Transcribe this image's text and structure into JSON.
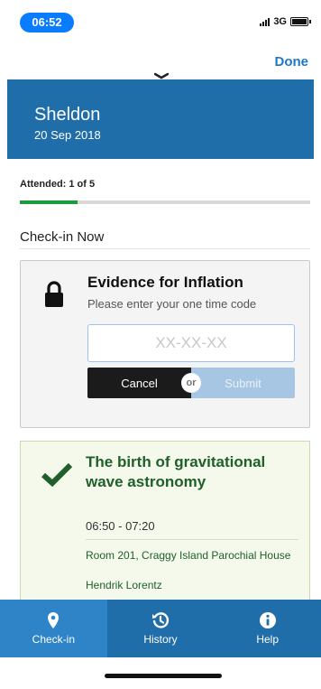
{
  "status_bar": {
    "time": "06:52",
    "network": "3G"
  },
  "header": {
    "done_label": "Done"
  },
  "banner": {
    "name": "Sheldon",
    "date": "20 Sep 2018"
  },
  "attendance": {
    "label": "Attended: 1 of 5",
    "attended": 1,
    "total": 5
  },
  "section_title": "Check-in Now",
  "evidence": {
    "title": "Evidence for Inflation",
    "subtitle": "Please enter your one time code",
    "code_placeholder": "XX-XX-XX",
    "code_value": "",
    "cancel_label": "Cancel",
    "or_label": "or",
    "submit_label": "Submit",
    "icon": "lock-icon"
  },
  "session": {
    "title": "The birth of gravitational wave astronomy",
    "time": "06:50 - 07:20",
    "room": "Room 201, Craggy Island Parochial House",
    "speaker": "Hendrik Lorentz",
    "icon": "checkmark-icon"
  },
  "tabs": [
    {
      "label": "Check-in",
      "icon": "location-pin-icon",
      "active": true
    },
    {
      "label": "History",
      "icon": "history-icon",
      "active": false
    },
    {
      "label": "Help",
      "icon": "info-icon",
      "active": false
    }
  ],
  "colors": {
    "brand": "#1f6eaa",
    "accent": "#1d78c8",
    "success": "#1c9a3c",
    "session_text": "#1f5f2a"
  }
}
